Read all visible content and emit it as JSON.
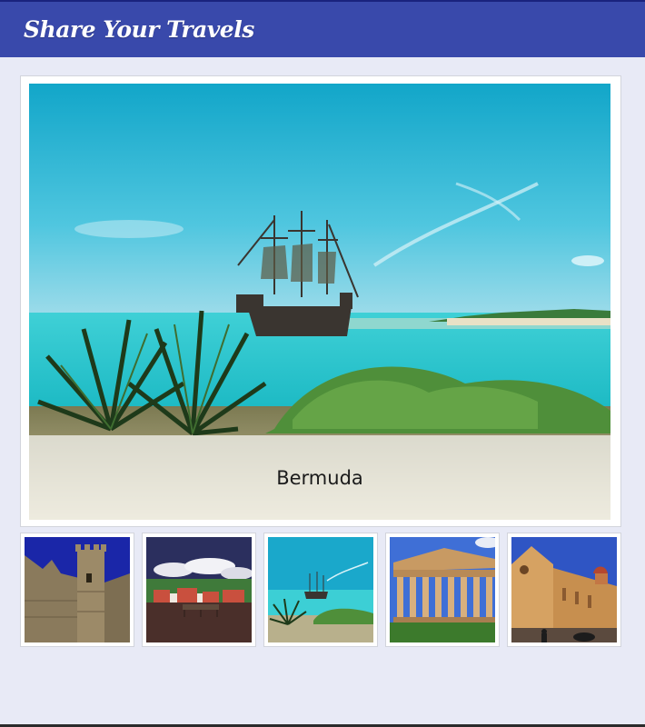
{
  "header": {
    "title": "Share Your Travels"
  },
  "feature": {
    "caption": "Bermuda",
    "image": "pirate-ship-beach-photo"
  },
  "thumbnails": [
    {
      "image": "castle-tower-photo"
    },
    {
      "image": "harbor-town-photo"
    },
    {
      "image": "pirate-ship-beach-photo"
    },
    {
      "image": "greek-temple-photo"
    },
    {
      "image": "church-facade-photo"
    }
  ],
  "colors": {
    "header_bg": "#3949ab",
    "page_bg": "#e8eaf6",
    "frame_bg": "#ffffff"
  }
}
